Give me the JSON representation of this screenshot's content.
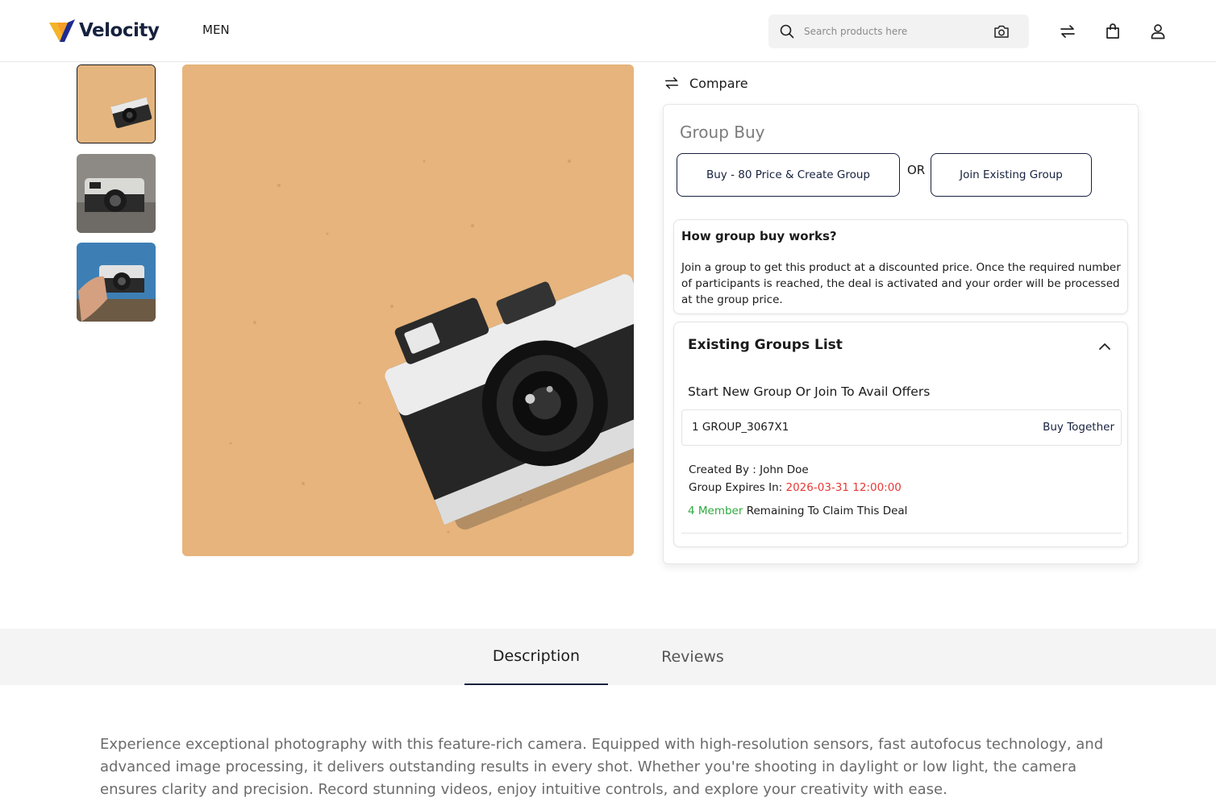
{
  "header": {
    "brand": "Velocity",
    "nav": [
      {
        "label": "MEN"
      }
    ],
    "search": {
      "placeholder": "Search products here",
      "value": ""
    },
    "icons": [
      "search-icon",
      "camera-icon",
      "compare-arrows-icon",
      "shopping-bag-icon",
      "user-icon"
    ]
  },
  "gallery": {
    "thumbnails": [
      {
        "alt": "camera on sand",
        "active": true
      },
      {
        "alt": "vintage camera",
        "active": false
      },
      {
        "alt": "hand holding camera",
        "active": false
      }
    ]
  },
  "compare": {
    "label": "Compare"
  },
  "group_buy": {
    "title": "Group Buy",
    "create_button": "Buy - 80 Price & Create Group",
    "or_label": "OR",
    "join_button": "Join Existing Group",
    "how": {
      "title": "How group buy works?",
      "text": "Join a group to get this product at a discounted price. Once the required number of participants is reached, the deal is activated and your order will be processed at the group price."
    },
    "existing": {
      "title": "Existing Groups List",
      "subtitle": "Start New Group Or Join To Avail Offers",
      "group_id": "1 GROUP_3067X1",
      "buy_together": "Buy Together",
      "created_by_label": "Created By : ",
      "created_by": "John Doe",
      "expires_label": "Group Expires In: ",
      "expires_value": "2026-03-31 12:00:00",
      "members_count": "4 Member",
      "members_text": " Remaining To Claim This Deal"
    }
  },
  "tabs": [
    {
      "label": "Description",
      "active": true
    },
    {
      "label": "Reviews",
      "active": false
    }
  ],
  "description": "Experience exceptional photography with this feature-rich camera. Equipped with high-resolution sensors, fast autofocus technology, and advanced image processing, it delivers outstanding results in every shot. Whether you're shooting in daylight or low light, the camera ensures clarity and precision. Record stunning videos, enjoy intuitive controls, and explore your creativity with ease.",
  "colors": {
    "brand": "#16213e",
    "accent": "#f5b427",
    "expires": "#e53935",
    "members": "#2eaa3f"
  }
}
